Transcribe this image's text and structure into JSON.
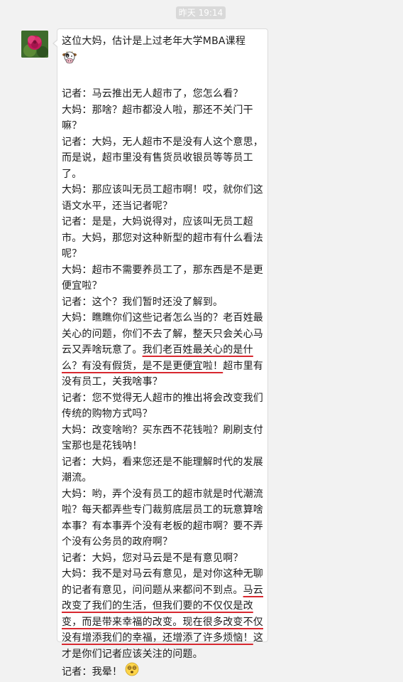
{
  "header": {
    "timestamp": "昨天 19:14"
  },
  "message": {
    "intro": "这位大妈，估计是上过老年大学MBA课程",
    "intro_emoji": "cow-face-icon",
    "dialogue": [
      {
        "text": "记者：马云推出无人超市了，您怎么看？"
      },
      {
        "text": "大妈：那啥？超市都没人啦，那还不关门干嘛？"
      },
      {
        "text": "记者：大妈，无人超市不是没有人这个意思，而是说，超市里没有售货员收银员等等员工了。"
      },
      {
        "text": "大妈：那应该叫无员工超市啊！哎，就你们这语文水平，还当记者呢？"
      },
      {
        "text": "记者：是是，大妈说得对，应该叫无员工超市。大妈，那您对这种新型的超市有什么看法呢？"
      },
      {
        "text": "大妈：超市不需要养员工了，那东西是不是更便宜啦？"
      },
      {
        "text": "记者：这个？我们暂时还没了解到。"
      },
      {
        "parts": [
          {
            "text": "大妈：瞧瞧你们这些记者怎么当的？老百姓最关心的问题，你们不去了解，整天只会关心马云又弄啥玩意了。",
            "underline": false
          },
          {
            "text": "我们老百姓最关心的是什么？有没有假货，是不是更便宜啦！",
            "underline": true
          },
          {
            "text": "超市里有没有员工，关我啥事？",
            "underline": false
          }
        ]
      },
      {
        "text": "记者：您不觉得无人超市的推出将会改变我们传统的购物方式吗？"
      },
      {
        "text": "大妈：改变啥哟？买东西不花钱啦？刷刷支付宝那也是花钱呐！"
      },
      {
        "text": "记者：大妈，看来您还是不能理解时代的发展潮流。"
      },
      {
        "text": "大妈：哟，弄个没有员工的超市就是时代潮流啦？每天都弄些专门裁剪底层员工的玩意算啥本事？有本事弄个没有老板的超市啊？要不弄个没有公务员的政府啊？"
      },
      {
        "text": "记者：大妈，您对马云是不是有意见啊？"
      },
      {
        "parts": [
          {
            "text": "大妈：我不是对马云有意见，是对你这种无聊的记者有意见，问问题从来都问不到点。",
            "underline": false
          },
          {
            "text": "马云改变了我们的生活，但我们要的不仅仅是改变，而是带来幸福的改变。现在很多改变不仅没有增添我们的幸福，还增添了许多烦恼！",
            "underline": true
          },
          {
            "text": "这才是你们记者应该关注的问题。",
            "underline": false
          }
        ]
      },
      {
        "text": "记者：我晕！",
        "emoji": "dizzy-face-icon"
      }
    ]
  },
  "colors": {
    "background": "#f2f2f2",
    "bubble": "#ffffff",
    "underline": "#d8282f",
    "text": "#1a1a1a"
  }
}
